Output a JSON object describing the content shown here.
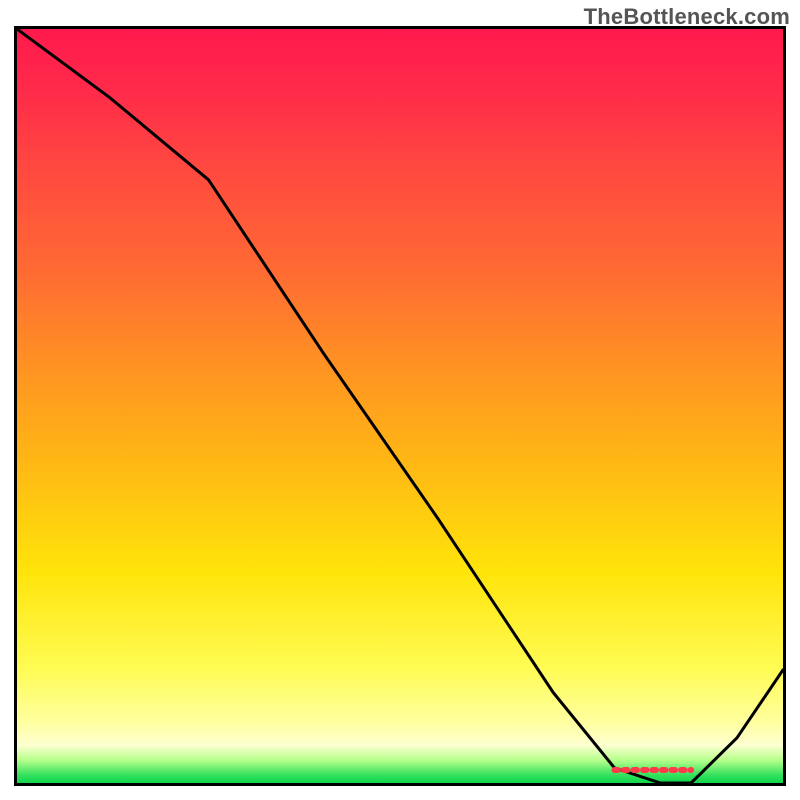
{
  "watermark": "TheBottleneck.com",
  "chart_data": {
    "type": "line",
    "title": "",
    "xlabel": "",
    "ylabel": "",
    "ylim": [
      0,
      100
    ],
    "xlim": [
      0,
      100
    ],
    "series": [
      {
        "name": "curve",
        "x": [
          0,
          12,
          25,
          40,
          55,
          70,
          78,
          84,
          88,
          94,
          100
        ],
        "values": [
          100,
          91,
          80,
          57,
          35,
          12,
          2,
          0,
          0,
          6,
          15
        ]
      }
    ],
    "marker": {
      "x_start": 78,
      "x_end": 88,
      "label": "",
      "color": "#ff3a4a"
    },
    "gradient_stops": [
      {
        "pos": 0.0,
        "color": "#ff1a4d"
      },
      {
        "pos": 0.32,
        "color": "#ff6a33"
      },
      {
        "pos": 0.58,
        "color": "#ffb914"
      },
      {
        "pos": 0.85,
        "color": "#fffc55"
      },
      {
        "pos": 0.97,
        "color": "#b4ff8a"
      },
      {
        "pos": 1.0,
        "color": "#12d64d"
      }
    ]
  }
}
